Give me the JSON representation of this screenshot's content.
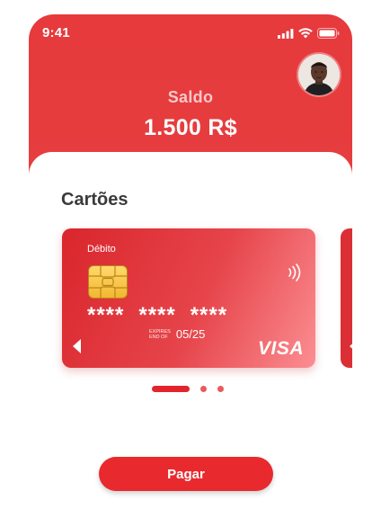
{
  "status_bar": {
    "time": "9:41"
  },
  "header": {
    "balance_label": "Saldo",
    "balance_value": "1.500 R$",
    "avatar_icon": "user-avatar"
  },
  "cards_section": {
    "title": "Cartões",
    "card": {
      "type": "Débito",
      "number_groups": [
        "****",
        "****",
        "****"
      ],
      "expiry_label": "EXPIRES END OF",
      "expiry_date": "05/25",
      "brand": "VISA",
      "chip_icon": "chip-icon",
      "contactless_icon": "contactless-icon",
      "arrow_icon": "left-arrow-icon"
    },
    "pager": {
      "count": 3,
      "active_index": 0
    }
  },
  "actions": {
    "pay_label": "Pagar"
  },
  "colors": {
    "primary": "#e63a3c",
    "button": "#e82a2f",
    "title_text": "#3a3a3a"
  }
}
